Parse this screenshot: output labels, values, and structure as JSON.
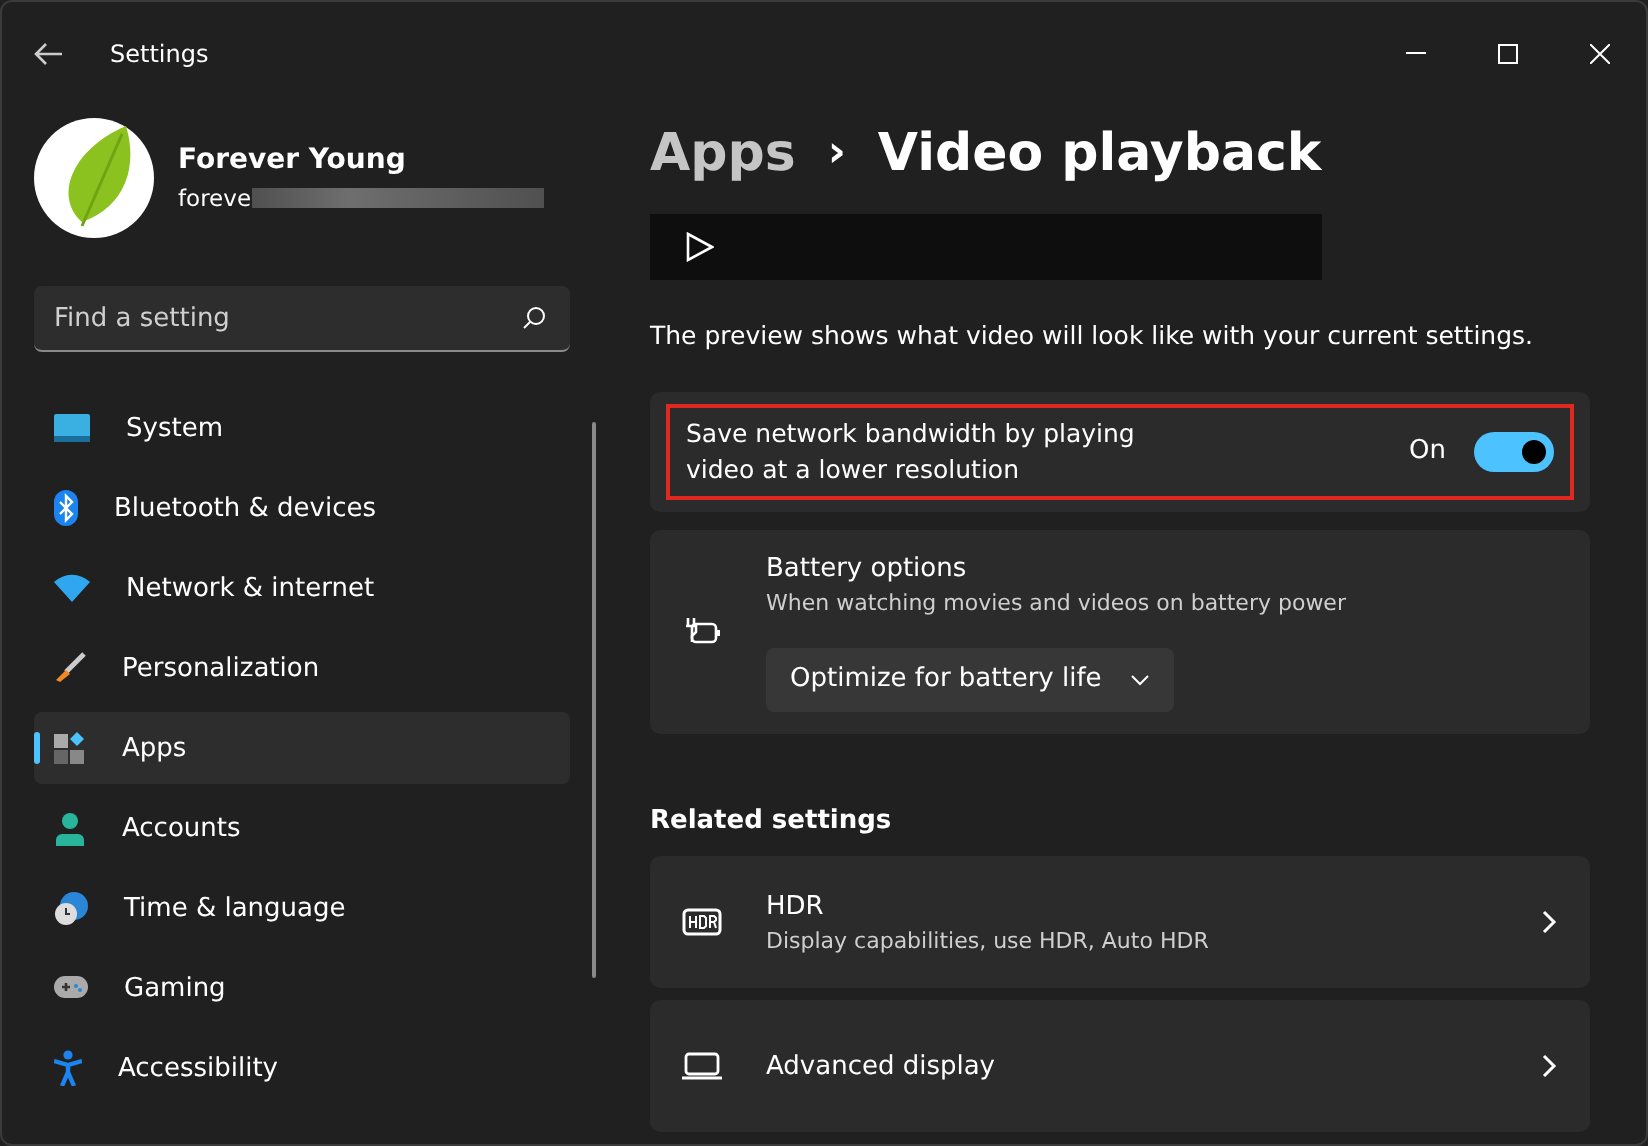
{
  "window": {
    "title": "Settings"
  },
  "profile": {
    "name": "Forever Young",
    "email": "foreve"
  },
  "search": {
    "placeholder": "Find a setting"
  },
  "sidebar": {
    "items": [
      {
        "label": "System",
        "selected": false
      },
      {
        "label": "Bluetooth & devices",
        "selected": false
      },
      {
        "label": "Network & internet",
        "selected": false
      },
      {
        "label": "Personalization",
        "selected": false
      },
      {
        "label": "Apps",
        "selected": true
      },
      {
        "label": "Accounts",
        "selected": false
      },
      {
        "label": "Time & language",
        "selected": false
      },
      {
        "label": "Gaming",
        "selected": false
      },
      {
        "label": "Accessibility",
        "selected": false
      }
    ]
  },
  "breadcrumb": {
    "parent": "Apps",
    "separator": "›",
    "current": "Video playback"
  },
  "preview_text": "The preview shows what video will look like with your current settings.",
  "bandwidth": {
    "label": "Save network bandwidth by playing video at a lower resolution",
    "state_label": "On",
    "on": true,
    "highlighted": true
  },
  "battery": {
    "title": "Battery options",
    "subtitle": "When watching movies and videos on battery power",
    "dropdown": "Optimize for battery life"
  },
  "related": {
    "heading": "Related settings",
    "items": [
      {
        "title": "HDR",
        "subtitle": "Display capabilities, use HDR, Auto HDR"
      },
      {
        "title": "Advanced display"
      }
    ]
  }
}
